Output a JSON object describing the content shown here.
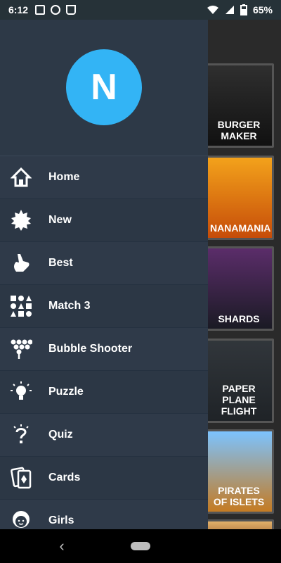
{
  "status_bar": {
    "time": "6:12",
    "battery": "65%",
    "icons": [
      "image-icon",
      "p-icon",
      "checkmark-icon"
    ]
  },
  "drawer": {
    "avatar_letter": "N",
    "items": [
      {
        "label": "Home",
        "icon": "home-icon"
      },
      {
        "label": "New",
        "icon": "starburst-icon"
      },
      {
        "label": "Best",
        "icon": "hand-icon"
      },
      {
        "label": "Match 3",
        "icon": "match3-icon"
      },
      {
        "label": "Bubble Shooter",
        "icon": "bubbles-icon"
      },
      {
        "label": "Puzzle",
        "icon": "lightbulb-icon"
      },
      {
        "label": "Quiz",
        "icon": "question-icon"
      },
      {
        "label": "Cards",
        "icon": "cards-icon"
      },
      {
        "label": "Girls",
        "icon": "girl-icon"
      }
    ]
  },
  "game_thumbnails": [
    "BURGER MAKER",
    "NANAMANIA",
    "SHARDS",
    "PAPER PLANE FLIGHT",
    "PIRATES OF ISLETS",
    ""
  ],
  "colors": {
    "drawer_bg": "#2d3947",
    "avatar_bg": "#33b4f5",
    "status_bar_bg": "#263238"
  }
}
